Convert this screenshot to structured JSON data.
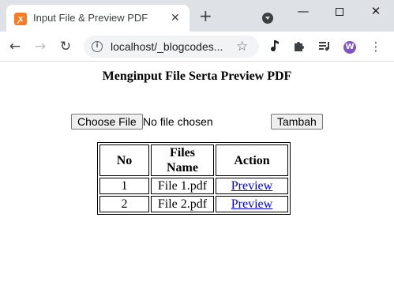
{
  "browser": {
    "tab_title": "Input File & Preview PDF",
    "tab_favicon": "xampp-icon",
    "tab_close": "✕",
    "new_tab": "+",
    "window_minimize": "—",
    "window_close": "✕",
    "url": "localhost/_blogcodes...",
    "nav": {
      "back": "←",
      "forward": "→",
      "reload": "↻"
    },
    "star": "☆",
    "menu": "⋮"
  },
  "page": {
    "title": "Menginput File Serta Preview PDF",
    "choose_file_label": "Choose File",
    "file_status": "No file chosen",
    "add_button_label": "Tambah"
  },
  "table": {
    "headers": [
      "No",
      "Files Name",
      "Action"
    ],
    "rows": [
      {
        "no": "1",
        "name": "File 1.pdf",
        "action": "Preview"
      },
      {
        "no": "2",
        "name": "File 2.pdf",
        "action": "Preview"
      }
    ]
  }
}
